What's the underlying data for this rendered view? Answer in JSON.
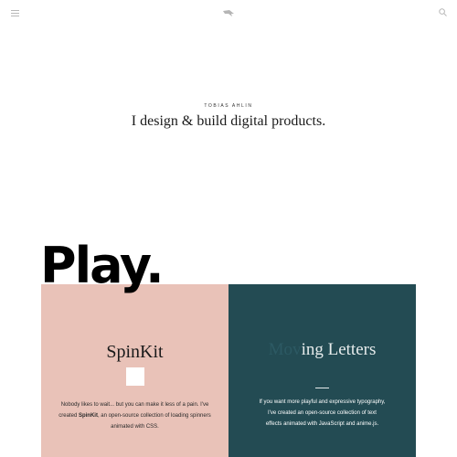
{
  "header": {
    "menu_icon": "hamburger-menu-icon",
    "logo_icon": "bird-logo-icon",
    "search_icon": "search-icon"
  },
  "hero": {
    "name": "TOBIAS AHLIN",
    "tagline": "I design & build digital products."
  },
  "section": {
    "heading": "Play."
  },
  "cards": [
    {
      "title": "SpinKit",
      "background": "#e9c2b8",
      "desc_1": "Nobody likes to wait... but you can make it less of a pain. I've created ",
      "desc_bold_1": "SpinKit",
      "desc_2": ", an open-source collection of loading spinners animated with CSS."
    },
    {
      "title_faded": "Mov",
      "title_visible": "ing Letters",
      "background": "#234b53",
      "desc_1": "If you want more playful and expressive typography,",
      "desc_2": "I've created an open-source collection of text",
      "desc_3": "effects animated with JavaScript and anime.js."
    }
  ]
}
